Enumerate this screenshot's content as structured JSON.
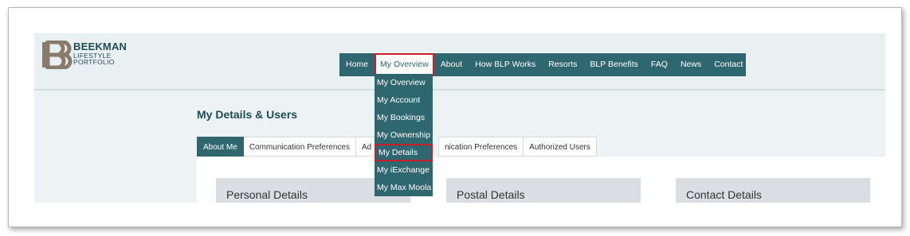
{
  "brand": {
    "name": "BEEKMAN",
    "sub1": "LIFESTYLE",
    "sub2": "PORTFOLIO",
    "logo_icon": "bb-monogram-icon",
    "color": "#8a7a6a"
  },
  "nav": {
    "items": [
      {
        "label": "Home"
      },
      {
        "label": "My Overview",
        "active": true
      },
      {
        "label": "About"
      },
      {
        "label": "How BLP Works"
      },
      {
        "label": "Resorts"
      },
      {
        "label": "BLP Benefits"
      },
      {
        "label": "FAQ"
      },
      {
        "label": "News"
      },
      {
        "label": "Contact"
      }
    ]
  },
  "dropdown": {
    "items": [
      {
        "label": "My Overview"
      },
      {
        "label": "My Account"
      },
      {
        "label": "My Bookings"
      },
      {
        "label": "My Ownership"
      },
      {
        "label": "My Details",
        "highlighted": true
      },
      {
        "label": "My iExchange"
      },
      {
        "label": "My Max Moola"
      }
    ]
  },
  "page": {
    "title": "My Details & Users"
  },
  "tabs": [
    {
      "label": "About Me",
      "active": true
    },
    {
      "label": "Communication Preferences"
    },
    {
      "label": "Ad"
    },
    {
      "label": "nication Preferences"
    },
    {
      "label": "Authorized Users"
    }
  ],
  "panels": [
    {
      "title": "Personal Details"
    },
    {
      "title": "Postal Details"
    },
    {
      "title": "Contact Details"
    }
  ],
  "colors": {
    "primary": "#2f6771",
    "highlight": "#cc1e2a",
    "background": "#edf3f4"
  }
}
